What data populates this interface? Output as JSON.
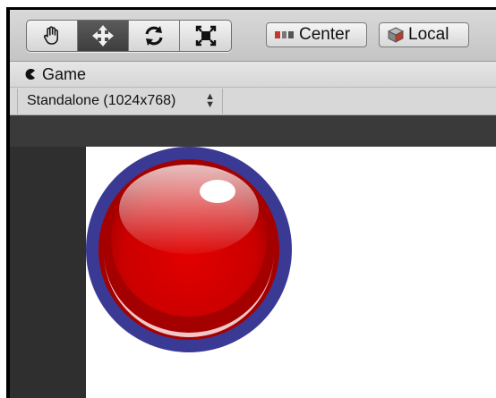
{
  "toolbar": {
    "tools": [
      {
        "name": "hand-tool",
        "icon": "hand-icon",
        "active": false
      },
      {
        "name": "move-tool",
        "icon": "move-arrows-icon",
        "active": true
      },
      {
        "name": "rotate-tool",
        "icon": "rotate-icon",
        "active": false
      },
      {
        "name": "scale-tool",
        "icon": "scale-icon",
        "active": false
      }
    ],
    "pivot_label": "Center",
    "pivot_icon": "pivot-center-icon",
    "space_label": "Local",
    "space_icon": "local-cube-icon"
  },
  "game_view": {
    "tab_label": "Game",
    "tab_icon": "game-pacman-icon",
    "resolution": "Standalone (1024x768)",
    "resolution_arrows": "▲▼"
  },
  "scene": {
    "object": "red-glossy-button",
    "colors": {
      "ring": "#3a3a94",
      "button_red": "#cc0000",
      "dark_red": "#a30000",
      "highlight": "#ffffff",
      "canvas": "#ffffff",
      "editor_bg": "#2f2f2f"
    }
  }
}
